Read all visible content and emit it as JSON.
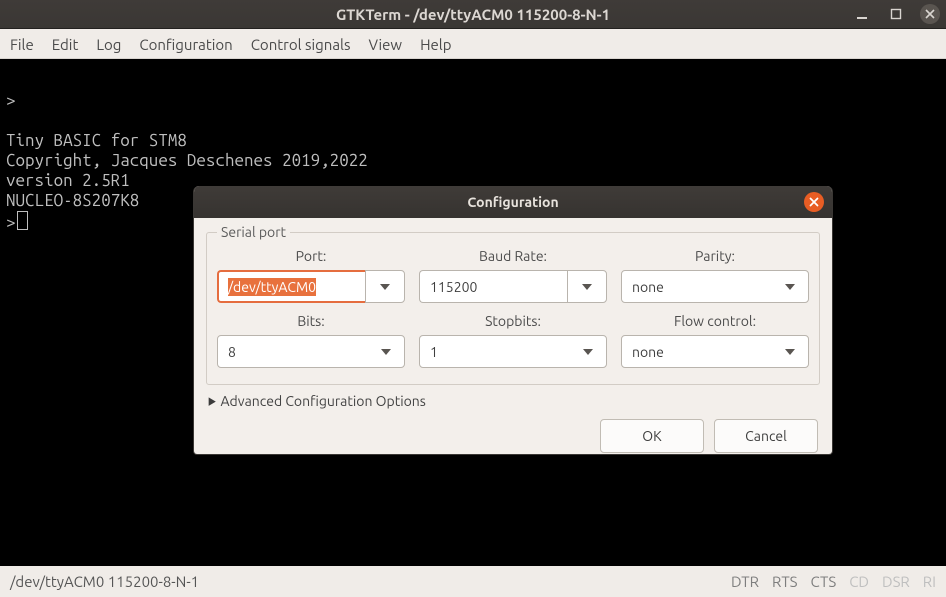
{
  "window": {
    "title": "GTKTerm - /dev/ttyACM0  115200-8-N-1"
  },
  "menu": [
    "File",
    "Edit",
    "Log",
    "Configuration",
    "Control signals",
    "View",
    "Help"
  ],
  "terminal": {
    "lines": [
      ">",
      "",
      "Tiny BASIC for STM8",
      "Copyright, Jacques Deschenes 2019,2022",
      "version 2.5R1",
      "NUCLEO-8S207K8",
      ">"
    ]
  },
  "statusbar": {
    "left": "/dev/ttyACM0  115200-8-N-1",
    "signals": [
      {
        "name": "DTR",
        "dim": false
      },
      {
        "name": "RTS",
        "dim": false
      },
      {
        "name": "CTS",
        "dim": false
      },
      {
        "name": "CD",
        "dim": true
      },
      {
        "name": "DSR",
        "dim": true
      },
      {
        "name": "RI",
        "dim": true
      }
    ]
  },
  "dialog": {
    "title": "Configuration",
    "group_label": "Serial port",
    "fields": {
      "port": {
        "label": "Port:",
        "value": "/dev/ttyACM0"
      },
      "baud": {
        "label": "Baud Rate:",
        "value": "115200"
      },
      "parity": {
        "label": "Parity:",
        "value": "none"
      },
      "bits": {
        "label": "Bits:",
        "value": "8"
      },
      "stopbits": {
        "label": "Stopbits:",
        "value": "1"
      },
      "flow": {
        "label": "Flow control:",
        "value": "none"
      }
    },
    "advanced_label": "Advanced Configuration Options",
    "buttons": {
      "ok": "OK",
      "cancel": "Cancel"
    }
  }
}
